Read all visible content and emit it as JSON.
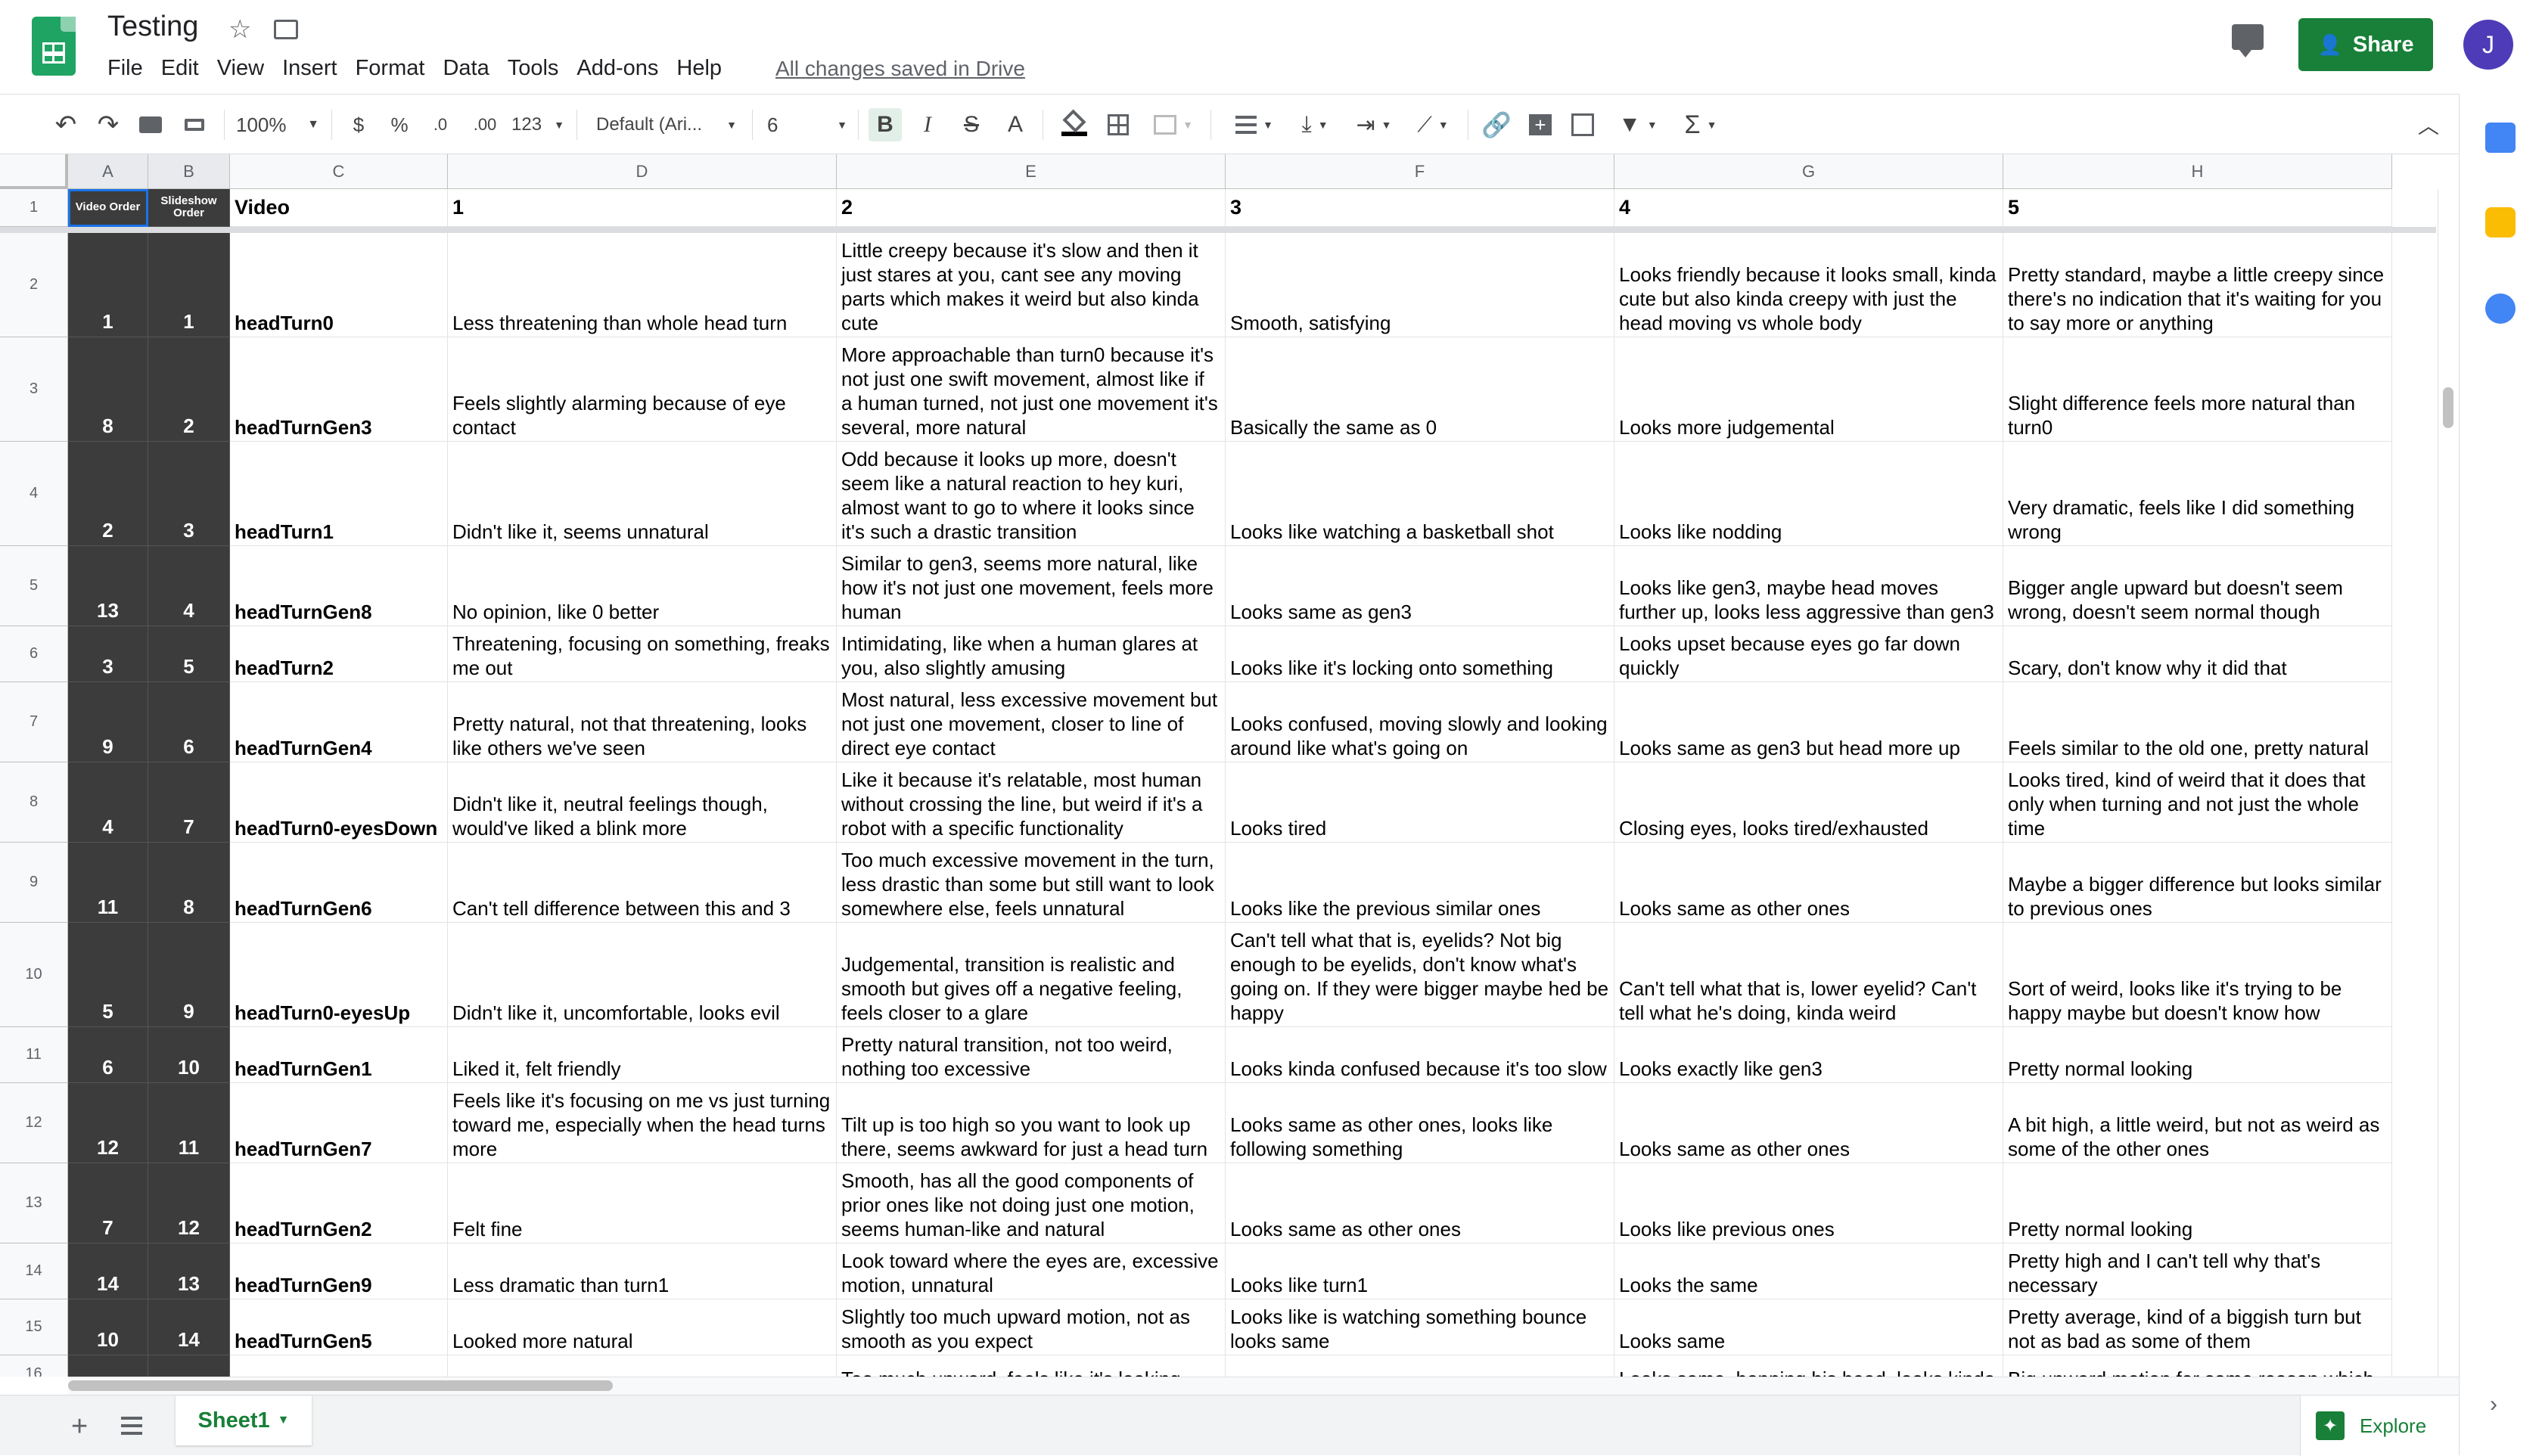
{
  "app": {
    "title": "Testing",
    "saved_status": "All changes saved in Drive",
    "share_label": "Share",
    "avatar_initial": "J"
  },
  "menu": [
    "File",
    "Edit",
    "View",
    "Insert",
    "Format",
    "Data",
    "Tools",
    "Add-ons",
    "Help"
  ],
  "toolbar": {
    "zoom": "100%",
    "currency": "$",
    "percent": "%",
    "dec_less": ".0",
    "dec_more": ".00",
    "more_formats": "123",
    "font": "Default (Ari...",
    "font_size": "6",
    "bold": "B",
    "italic": "I",
    "strike": "S",
    "text_color": "A"
  },
  "columns": [
    "A",
    "B",
    "C",
    "D",
    "E",
    "F",
    "G",
    "H"
  ],
  "header_row": {
    "num": "1",
    "a": "Video Order",
    "b": "Slideshow Order",
    "c": "Video",
    "d": "1",
    "e": "2",
    "f": "3",
    "g": "4",
    "h": "5"
  },
  "rows": [
    {
      "num": "2",
      "a": "1",
      "b": "1",
      "c": "headTurn0",
      "d": "Less threatening than whole head turn",
      "e": "Little creepy because it's slow and then it just stares at you, cant see any moving parts which makes it weird but also kinda cute",
      "f": "Smooth, satisfying",
      "g": "Looks friendly because it looks small, kinda cute but also kinda creepy with just the head moving vs whole body",
      "h": "Pretty standard, maybe a little creepy since there's no indication that it's waiting for you to say more or anything"
    },
    {
      "num": "3",
      "a": "8",
      "b": "2",
      "c": "headTurnGen3",
      "d": "Feels slightly alarming because of eye contact",
      "e": "More approachable than turn0 because it's not just one swift movement, almost like if a human turned, not just one movement it's several, more natural",
      "f": "Basically the same as 0",
      "g": "Looks more judgemental",
      "h": "Slight difference feels more natural than turn0"
    },
    {
      "num": "4",
      "a": "2",
      "b": "3",
      "c": "headTurn1",
      "d": "Didn't like it, seems unnatural",
      "e": "Odd because it looks up more, doesn't seem like a natural reaction to hey kuri, almost want to go to where it looks since it's such a drastic transition",
      "f": "Looks like watching a basketball shot",
      "g": "Looks like nodding",
      "h": "Very dramatic, feels like I did something wrong"
    },
    {
      "num": "5",
      "a": "13",
      "b": "4",
      "c": "headTurnGen8",
      "d": "No opinion, like 0 better",
      "e": "Similar to gen3, seems more natural, like how it's not just one movement, feels more human",
      "f": "Looks same as gen3",
      "g": "Looks like gen3, maybe head moves further up, looks less aggressive than gen3",
      "h": "Bigger angle upward but doesn't seem wrong, doesn't seem normal though"
    },
    {
      "num": "6",
      "a": "3",
      "b": "5",
      "c": "headTurn2",
      "d": "Threatening, focusing on something, freaks me out",
      "e": "Intimidating, like when a human glares at you, also slightly amusing",
      "f": "Looks like it's locking onto something",
      "g": "Looks upset because eyes go far down quickly",
      "h": "Scary, don't know why it did that"
    },
    {
      "num": "7",
      "a": "9",
      "b": "6",
      "c": "headTurnGen4",
      "d": "Pretty natural, not that threatening, looks like others we've seen",
      "e": "Most natural, less excessive movement but not just one movement, closer to line of direct eye contact",
      "f": "Looks confused, moving slowly and looking around like what's going on",
      "g": "Looks same as gen3 but head more up",
      "h": "Feels similar to the old one, pretty natural"
    },
    {
      "num": "8",
      "a": "4",
      "b": "7",
      "c": "headTurn0-eyesDown",
      "d": "Didn't like it, neutral feelings though, would've liked a blink more",
      "e": "Like it because it's relatable, most human without crossing the line, but weird if it's a robot with a specific functionality",
      "f": "Looks tired",
      "g": "Closing eyes, looks tired/exhausted",
      "h": "Looks tired, kind of weird that it does that only when turning and not just the whole time"
    },
    {
      "num": "9",
      "a": "11",
      "b": "8",
      "c": "headTurnGen6",
      "d": "Can't tell difference between this and 3",
      "e": "Too much excessive movement in the turn, less drastic than some but still want to look somewhere else, feels unnatural",
      "f": "Looks like the previous similar ones",
      "g": "Looks same as other ones",
      "h": "Maybe a bigger difference but looks similar to previous ones"
    },
    {
      "num": "10",
      "a": "5",
      "b": "9",
      "c": "headTurn0-eyesUp",
      "d": "Didn't like it, uncomfortable, looks evil",
      "e": "Judgemental, transition is realistic and smooth but gives off a negative feeling, feels closer to a glare",
      "f": "Can't tell what that is, eyelids? Not big enough to be eyelids, don't know what's going on. If they were bigger maybe hed be happy",
      "g": "Can't tell what that is, lower eyelid? Can't tell what he's doing, kinda weird",
      "h": "Sort of weird, looks like it's trying to be happy maybe but doesn't know how"
    },
    {
      "num": "11",
      "a": "6",
      "b": "10",
      "c": "headTurnGen1",
      "d": "Liked it, felt friendly",
      "e": "Pretty natural transition, not too weird, nothing too excessive",
      "f": "Looks kinda confused because it's too slow",
      "g": "Looks exactly like gen3",
      "h": "Pretty normal looking"
    },
    {
      "num": "12",
      "a": "12",
      "b": "11",
      "c": "headTurnGen7",
      "d": "Feels like it's focusing on me vs just turning toward me, especially when the head turns more",
      "e": "Tilt up is too high so you want to look up there, seems awkward for just a head turn",
      "f": "Looks same as other ones, looks like following something",
      "g": "Looks same as other ones",
      "h": "A bit high, a little weird, but not as weird as some of the other ones"
    },
    {
      "num": "13",
      "a": "7",
      "b": "12",
      "c": "headTurnGen2",
      "d": "Felt fine",
      "e": "Smooth, has all the good components of prior ones like not doing just one motion, seems human-like and natural",
      "f": "Looks same as other ones",
      "g": "Looks like previous ones",
      "h": "Pretty normal looking"
    },
    {
      "num": "14",
      "a": "14",
      "b": "13",
      "c": "headTurnGen9",
      "d": "Less dramatic than turn1",
      "e": "Look toward where the eyes are, excessive motion, unnatural",
      "f": "Looks like turn1",
      "g": "Looks the same",
      "h": "Pretty high and I can't tell why that's necessary"
    },
    {
      "num": "15",
      "a": "10",
      "b": "14",
      "c": "headTurnGen5",
      "d": "Looked more natural",
      "e": "Slightly too much upward motion, not as smooth as you expect",
      "f": "Looks like is watching something bounce looks same",
      "g": "Looks same",
      "h": "Pretty average, kind of a biggish turn but not as bad as some of them"
    },
    {
      "num": "16",
      "a": "",
      "b": "",
      "c": "",
      "d": "",
      "e": "Too much upward, feels like it's looking",
      "f": "",
      "g": "Looks same, bopping his head, looks kinda",
      "h": "Big upward motion for some reason which"
    }
  ],
  "sheet_tab": "Sheet1",
  "explore_label": "Explore",
  "colors": {
    "green": "#188038",
    "dark_cell": "#3c3c3c",
    "avatar": "#4e3bb8"
  }
}
